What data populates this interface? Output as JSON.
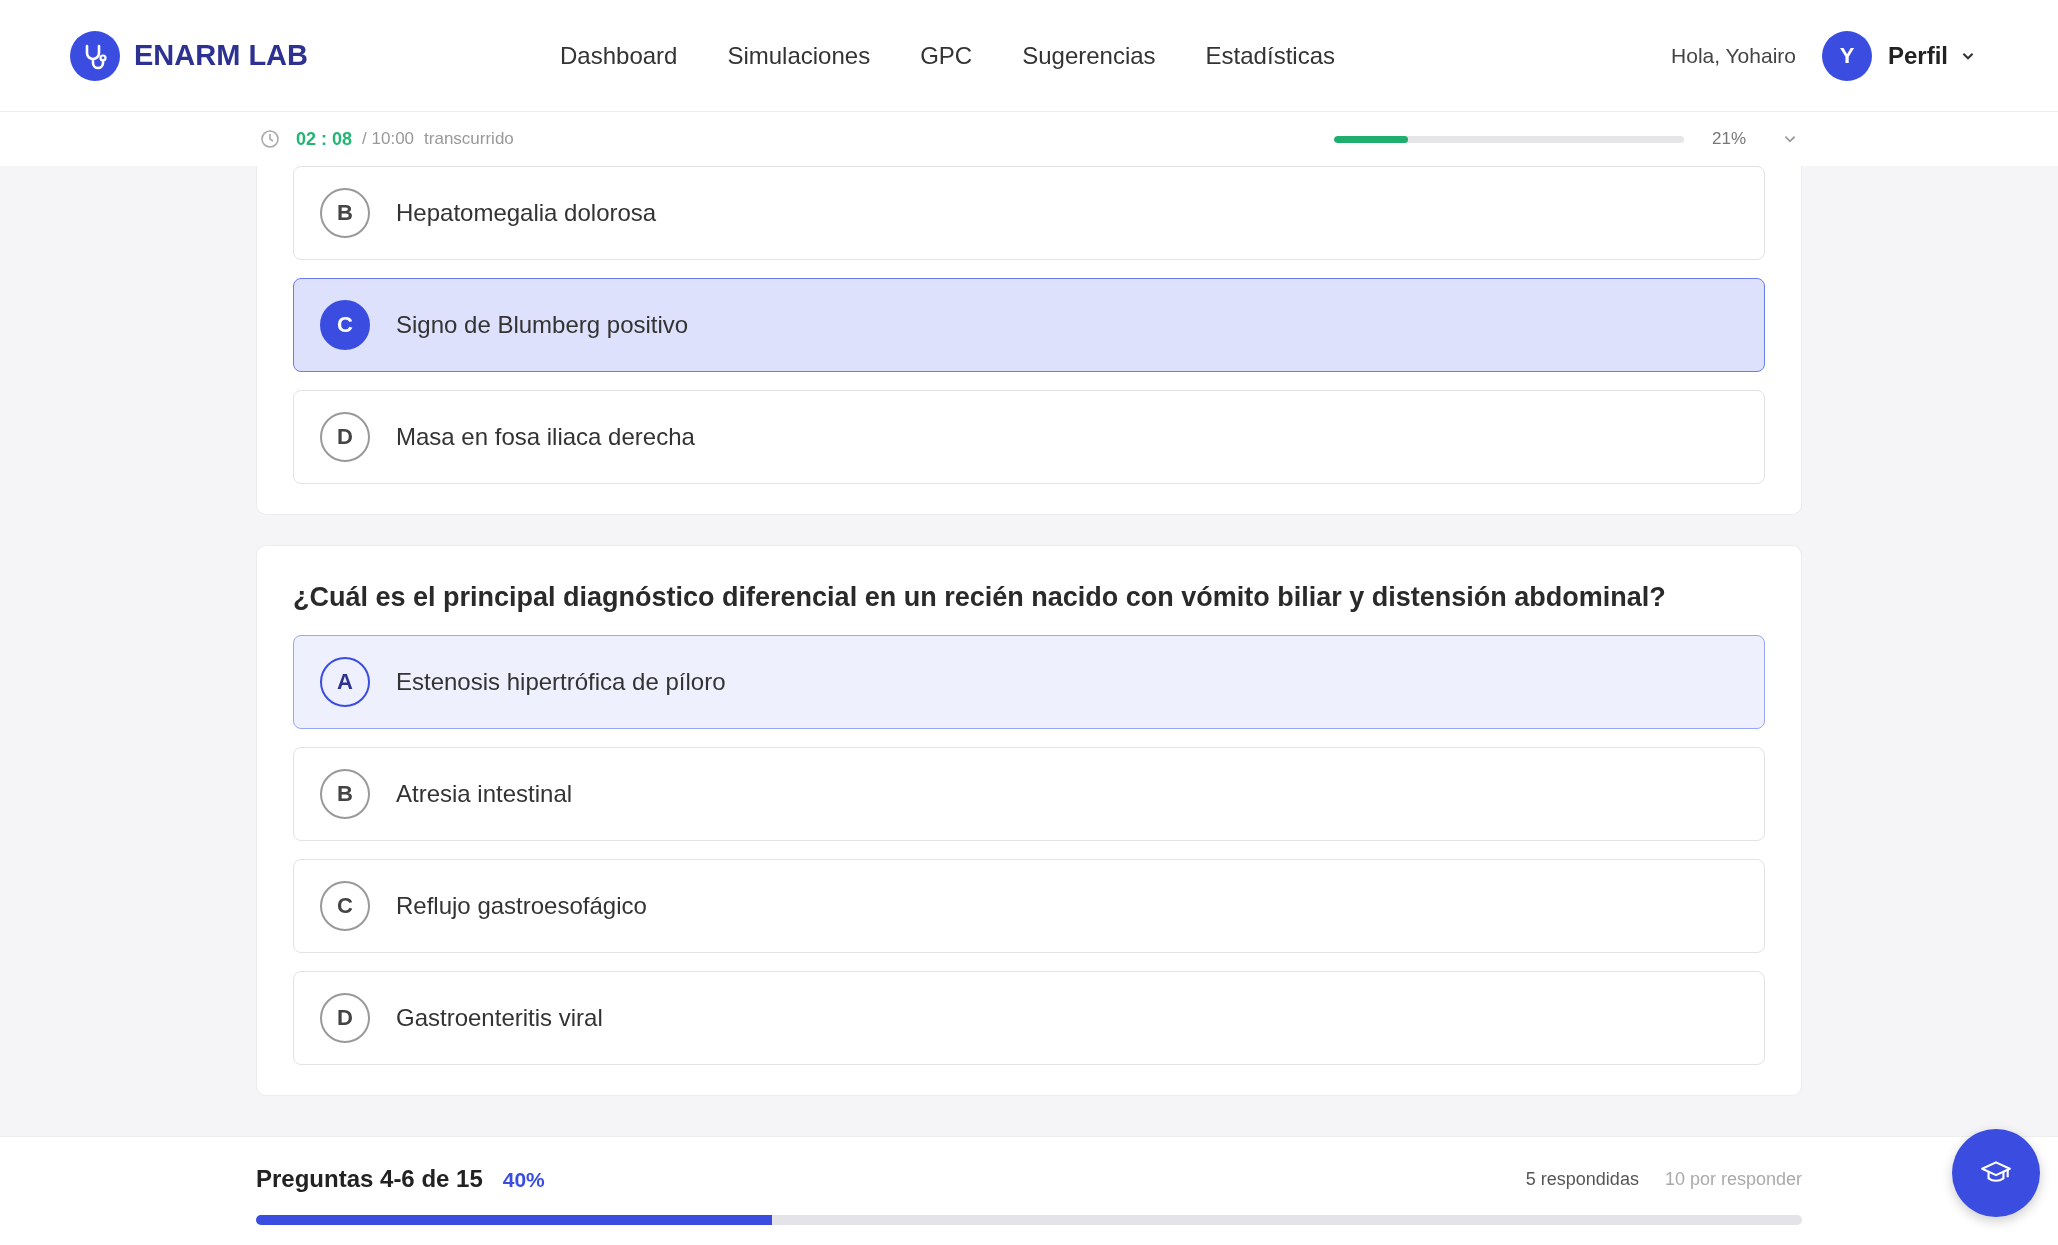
{
  "header": {
    "brand": "ENARM LAB",
    "nav": [
      "Dashboard",
      "Simulaciones",
      "GPC",
      "Sugerencias",
      "Estadísticas"
    ],
    "greeting": "Hola, Yohairo",
    "avatar": "Y",
    "profile": "Perfil"
  },
  "timer": {
    "elapsed": "02 : 08",
    "total": "/ 10:00",
    "caption": "transcurrido",
    "level": 0.21,
    "percent": "21%"
  },
  "questions": [
    {
      "options": [
        {
          "letter": "B",
          "text": "Hepatomegalia dolorosa",
          "selected": false,
          "hovered": false
        },
        {
          "letter": "C",
          "text": "Signo de Blumberg positivo",
          "selected": true,
          "hovered": false
        },
        {
          "letter": "D",
          "text": "Masa en fosa iliaca derecha",
          "selected": false,
          "hovered": false
        }
      ]
    },
    {
      "question": "¿Cuál es el principal diagnóstico diferencial en un recién nacido con vómito biliar y distensión abdominal?",
      "options": [
        {
          "letter": "A",
          "text": "Estenosis hipertrófica de píloro",
          "selected": false,
          "hovered": true
        },
        {
          "letter": "B",
          "text": "Atresia intestinal",
          "selected": false,
          "hovered": false
        },
        {
          "letter": "C",
          "text": "Reflujo gastroesofágico",
          "selected": false,
          "hovered": false
        },
        {
          "letter": "D",
          "text": "Gastroenteritis viral",
          "selected": false,
          "hovered": false
        }
      ]
    }
  ],
  "footer": {
    "range": "Preguntas 4-6 de 15",
    "percent": "40%",
    "answered": "5 respondidas",
    "pending": "10 por responder",
    "level": 0.334
  }
}
